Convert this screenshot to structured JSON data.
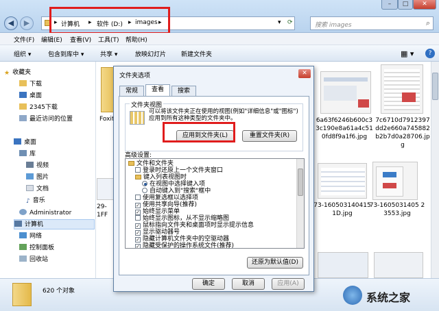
{
  "window": {
    "breadcrumb": [
      "计算机",
      "软件 (D:)",
      "images"
    ],
    "search_placeholder": "搜索 images",
    "menu": [
      "文件(F)",
      "编辑(E)",
      "查看(V)",
      "工具(T)",
      "帮助(H)"
    ],
    "toolbar": [
      "组织 ▾",
      "包含到库中 ▾",
      "共享 ▾",
      "放映幻灯片",
      "新建文件夹"
    ]
  },
  "nav": {
    "favorites_label": "收藏夹",
    "favorites": [
      "下载",
      "桌面",
      "2345下载",
      "最近访问的位置"
    ],
    "desktop_label": "桌面",
    "library_label": "库",
    "libraries": [
      "视频",
      "图片",
      "文档",
      "音乐"
    ],
    "admin": "Administrator",
    "computer": "计算机",
    "network": "网络",
    "control_panel": "控制面板",
    "recycle": "回收站"
  },
  "files": {
    "folder1": "Foxit",
    "file2_caption": "29-1FF",
    "file3_caption": "6a63f6246b600c33c190e8a61a4c510fd8f9a1f6.jpg",
    "file4_caption": "7c6710d7912397dd2e660a745882b2b7d0a28706.jpg",
    "file5_caption": "73-1605031404151D.jpg",
    "file6_caption": "73-1605031405 23553.jpg"
  },
  "status": {
    "count": "620 个对象"
  },
  "dialog": {
    "title": "文件夹选项",
    "tabs": [
      "常规",
      "查看",
      "搜索"
    ],
    "group_title": "文件夹视图",
    "group_text": "可以将该文件夹正在使用的视图(例如\"详细信息\"或\"图标\")应用到所有这种类型的文件夹中。",
    "apply_button": "应用到文件夹(L)",
    "reset_button": "重置文件夹(R)",
    "advanced_label": "高级设置:",
    "tree_items": [
      {
        "text": "文件和文件夹",
        "kind": "folder",
        "indent": 0
      },
      {
        "text": "登录时还原上一个文件夹窗口",
        "kind": "check",
        "checked": false,
        "indent": 1
      },
      {
        "text": "键入列表视图时",
        "kind": "folder",
        "indent": 1
      },
      {
        "text": "在视图中选择键入项",
        "kind": "radio",
        "checked": true,
        "indent": 2
      },
      {
        "text": "自动键入到\"搜索\"框中",
        "kind": "radio",
        "checked": false,
        "indent": 2
      },
      {
        "text": "使用复选框以选择项",
        "kind": "check",
        "checked": false,
        "indent": 1
      },
      {
        "text": "使用共享向导(推荐)",
        "kind": "check",
        "checked": true,
        "indent": 1
      },
      {
        "text": "始终显示菜单",
        "kind": "check",
        "checked": true,
        "indent": 1
      },
      {
        "text": "始终显示图标，从不显示缩略图",
        "kind": "check",
        "checked": false,
        "indent": 1
      },
      {
        "text": "鼠标指向文件夹和桌面项时显示提示信息",
        "kind": "check",
        "checked": true,
        "indent": 1
      },
      {
        "text": "显示驱动器号",
        "kind": "check",
        "checked": true,
        "indent": 1
      },
      {
        "text": "隐藏计算机文件夹中的空驱动器",
        "kind": "check",
        "checked": true,
        "indent": 1
      },
      {
        "text": "隐藏受保护的操作系统文件(推荐)",
        "kind": "check",
        "checked": true,
        "indent": 1
      }
    ],
    "restore_defaults": "还原为默认值(D)",
    "ok": "确定",
    "cancel": "取消",
    "apply": "应用(A)"
  },
  "watermark": "系统之家"
}
